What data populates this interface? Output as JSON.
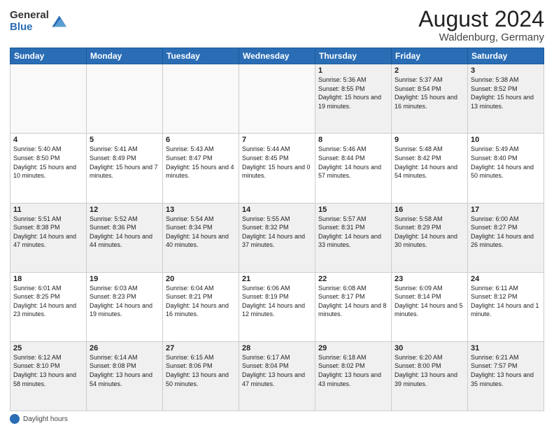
{
  "header": {
    "logo_general": "General",
    "logo_blue": "Blue",
    "month_year": "August 2024",
    "location": "Waldenburg, Germany"
  },
  "footer": {
    "label": "Daylight hours"
  },
  "days_of_week": [
    "Sunday",
    "Monday",
    "Tuesday",
    "Wednesday",
    "Thursday",
    "Friday",
    "Saturday"
  ],
  "weeks": [
    [
      {
        "day": "",
        "empty": true
      },
      {
        "day": "",
        "empty": true
      },
      {
        "day": "",
        "empty": true
      },
      {
        "day": "",
        "empty": true
      },
      {
        "day": "1",
        "sunrise": "5:36 AM",
        "sunset": "8:55 PM",
        "daylight": "15 hours and 19 minutes."
      },
      {
        "day": "2",
        "sunrise": "5:37 AM",
        "sunset": "8:54 PM",
        "daylight": "15 hours and 16 minutes."
      },
      {
        "day": "3",
        "sunrise": "5:38 AM",
        "sunset": "8:52 PM",
        "daylight": "15 hours and 13 minutes."
      }
    ],
    [
      {
        "day": "4",
        "sunrise": "5:40 AM",
        "sunset": "8:50 PM",
        "daylight": "15 hours and 10 minutes."
      },
      {
        "day": "5",
        "sunrise": "5:41 AM",
        "sunset": "8:49 PM",
        "daylight": "15 hours and 7 minutes."
      },
      {
        "day": "6",
        "sunrise": "5:43 AM",
        "sunset": "8:47 PM",
        "daylight": "15 hours and 4 minutes."
      },
      {
        "day": "7",
        "sunrise": "5:44 AM",
        "sunset": "8:45 PM",
        "daylight": "15 hours and 0 minutes."
      },
      {
        "day": "8",
        "sunrise": "5:46 AM",
        "sunset": "8:44 PM",
        "daylight": "14 hours and 57 minutes."
      },
      {
        "day": "9",
        "sunrise": "5:48 AM",
        "sunset": "8:42 PM",
        "daylight": "14 hours and 54 minutes."
      },
      {
        "day": "10",
        "sunrise": "5:49 AM",
        "sunset": "8:40 PM",
        "daylight": "14 hours and 50 minutes."
      }
    ],
    [
      {
        "day": "11",
        "sunrise": "5:51 AM",
        "sunset": "8:38 PM",
        "daylight": "14 hours and 47 minutes."
      },
      {
        "day": "12",
        "sunrise": "5:52 AM",
        "sunset": "8:36 PM",
        "daylight": "14 hours and 44 minutes."
      },
      {
        "day": "13",
        "sunrise": "5:54 AM",
        "sunset": "8:34 PM",
        "daylight": "14 hours and 40 minutes."
      },
      {
        "day": "14",
        "sunrise": "5:55 AM",
        "sunset": "8:32 PM",
        "daylight": "14 hours and 37 minutes."
      },
      {
        "day": "15",
        "sunrise": "5:57 AM",
        "sunset": "8:31 PM",
        "daylight": "14 hours and 33 minutes."
      },
      {
        "day": "16",
        "sunrise": "5:58 AM",
        "sunset": "8:29 PM",
        "daylight": "14 hours and 30 minutes."
      },
      {
        "day": "17",
        "sunrise": "6:00 AM",
        "sunset": "8:27 PM",
        "daylight": "14 hours and 26 minutes."
      }
    ],
    [
      {
        "day": "18",
        "sunrise": "6:01 AM",
        "sunset": "8:25 PM",
        "daylight": "14 hours and 23 minutes."
      },
      {
        "day": "19",
        "sunrise": "6:03 AM",
        "sunset": "8:23 PM",
        "daylight": "14 hours and 19 minutes."
      },
      {
        "day": "20",
        "sunrise": "6:04 AM",
        "sunset": "8:21 PM",
        "daylight": "14 hours and 16 minutes."
      },
      {
        "day": "21",
        "sunrise": "6:06 AM",
        "sunset": "8:19 PM",
        "daylight": "14 hours and 12 minutes."
      },
      {
        "day": "22",
        "sunrise": "6:08 AM",
        "sunset": "8:17 PM",
        "daylight": "14 hours and 8 minutes."
      },
      {
        "day": "23",
        "sunrise": "6:09 AM",
        "sunset": "8:14 PM",
        "daylight": "14 hours and 5 minutes."
      },
      {
        "day": "24",
        "sunrise": "6:11 AM",
        "sunset": "8:12 PM",
        "daylight": "14 hours and 1 minute."
      }
    ],
    [
      {
        "day": "25",
        "sunrise": "6:12 AM",
        "sunset": "8:10 PM",
        "daylight": "13 hours and 58 minutes."
      },
      {
        "day": "26",
        "sunrise": "6:14 AM",
        "sunset": "8:08 PM",
        "daylight": "13 hours and 54 minutes."
      },
      {
        "day": "27",
        "sunrise": "6:15 AM",
        "sunset": "8:06 PM",
        "daylight": "13 hours and 50 minutes."
      },
      {
        "day": "28",
        "sunrise": "6:17 AM",
        "sunset": "8:04 PM",
        "daylight": "13 hours and 47 minutes."
      },
      {
        "day": "29",
        "sunrise": "6:18 AM",
        "sunset": "8:02 PM",
        "daylight": "13 hours and 43 minutes."
      },
      {
        "day": "30",
        "sunrise": "6:20 AM",
        "sunset": "8:00 PM",
        "daylight": "13 hours and 39 minutes."
      },
      {
        "day": "31",
        "sunrise": "6:21 AM",
        "sunset": "7:57 PM",
        "daylight": "13 hours and 35 minutes."
      }
    ]
  ]
}
